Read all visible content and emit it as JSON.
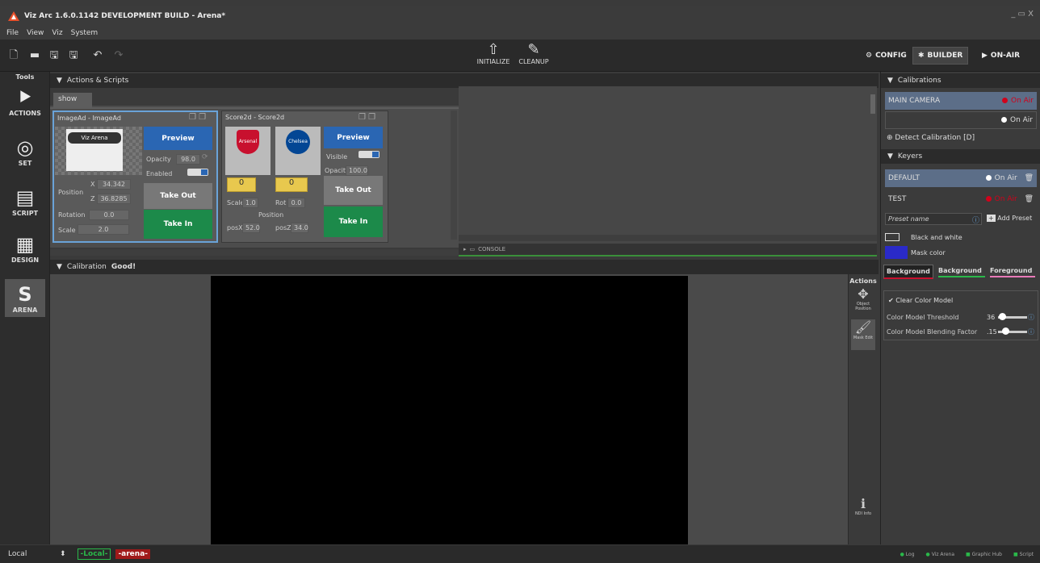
{
  "window": {
    "title": "Viz Arc 1.6.0.1142 DEVELOPMENT BUILD - Arena*",
    "controls": "_ ▭ X"
  },
  "menu": [
    "File",
    "View",
    "Viz",
    "System"
  ],
  "toolbar": {
    "initialize": "INITIALIZE",
    "cleanup": "CLEANUP",
    "config": "CONFIG",
    "builder": "BUILDER",
    "onair": "ON-AIR"
  },
  "tools": {
    "header": "Tools",
    "actions": "ACTIONS",
    "set": "SET",
    "script": "SCRIPT",
    "design": "DESIGN",
    "arena": "ARENA"
  },
  "actions_scripts": {
    "header": "Actions & Scripts",
    "tab": "show"
  },
  "card1": {
    "title": "ImageAd - ImageAd",
    "preview": "Preview",
    "opacity_label": "Opacity",
    "opacity": "98.0",
    "enabled_label": "Enabled",
    "position_label": "Position",
    "x_label": "X",
    "x": "34.342",
    "z_label": "Z",
    "z": "36.8285",
    "rotation_label": "Rotation",
    "rotation": "0.0",
    "scale_label": "Scale",
    "scale": "2.0",
    "take_out": "Take Out",
    "take_in": "Take In",
    "thumb_text": "Viz Arena"
  },
  "card2": {
    "title": "Score2d - Score2d",
    "preview": "Preview",
    "visible_label": "Visible",
    "opacity_label": "Opacity",
    "opacity": "100.0",
    "score1": "0",
    "score2": "0",
    "scale_label": "Scale",
    "scale": "1.0",
    "rot_label": "Rot",
    "rot": "0.0",
    "position_label": "Position",
    "posx_label": "posX",
    "posx": "52.0",
    "posz_label": "posZ",
    "posz": "34.0",
    "take_out": "Take Out",
    "take_in": "Take In",
    "team1": "Arsenal",
    "team2": "Chelsea"
  },
  "console": {
    "label": "CONSOLE"
  },
  "calibration": {
    "label": "Calibration",
    "status": "Good!"
  },
  "actions_sidebar": {
    "header": "Actions",
    "object_position": "Object Position",
    "mask_edit": "Mask Edit",
    "ndi_info": "NDI Info"
  },
  "right": {
    "calibrations_header": "Calibrations",
    "main_camera": "MAIN CAMERA",
    "on_air": "On Air",
    "on_air2": "On Air",
    "detect": "Detect Calibration [D]",
    "keyers_header": "Keyers",
    "keyer_default": "DEFAULT",
    "keyer_default_status": "On Air",
    "keyer_test": "TEST",
    "keyer_test_status": "On Air",
    "preset_placeholder": "Preset name",
    "add_preset": "Add Preset",
    "black_white": "Black and white",
    "mask_color": "Mask color",
    "tab_background": "Background",
    "tab_background2": "Background",
    "tab_foreground": "Foreground",
    "clear_color_model": "Clear Color Model",
    "threshold_label": "Color Model Threshold",
    "threshold": "36",
    "blending_label": "Color Model Blending Factor",
    "blending": ".15"
  },
  "statusbar": {
    "local": "Local",
    "profile_local": "-Local-",
    "profile_arena": "-arena-",
    "log": "Log",
    "viz_arena": "Viz Arena",
    "graphic_hub": "Graphic Hub",
    "script": "Script"
  },
  "colors": {
    "accent_blue": "#2a66b3",
    "green": "#1c8a4a",
    "red": "#d0021b",
    "yellow": "#e8c84e",
    "mask_color": "#2a2ac8"
  }
}
